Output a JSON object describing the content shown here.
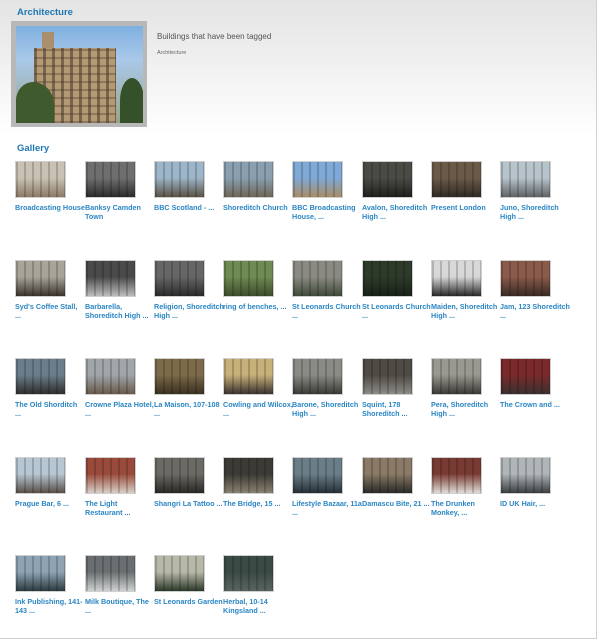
{
  "header": {
    "title": "Architecture",
    "description": "Buildings that have been tagged",
    "category": "Architecture"
  },
  "gallery": {
    "title": "Gallery",
    "items": [
      {
        "caption": "Broadcasting House"
      },
      {
        "caption": "Banksy Camden Town"
      },
      {
        "caption": "BBC Scotland - ..."
      },
      {
        "caption": "Shoreditch Church"
      },
      {
        "caption": "BBC Broadcasting House, ..."
      },
      {
        "caption": "Avalon, Shoreditch High ..."
      },
      {
        "caption": "Present London"
      },
      {
        "caption": "Juno, Shoreditch High ..."
      },
      {
        "caption": "Syd's Coffee Stall, ..."
      },
      {
        "caption": "Barbarella, Shoreditch High ..."
      },
      {
        "caption": "Religion, Shoreditch High ..."
      },
      {
        "caption": "ring of benches, ..."
      },
      {
        "caption": "St Leonards Church ..."
      },
      {
        "caption": "St Leonards Church ..."
      },
      {
        "caption": "Maiden, Shoreditch High ..."
      },
      {
        "caption": "Jam, 123 Shoreditch ..."
      },
      {
        "caption": "The Old Shorditch ..."
      },
      {
        "caption": "Crowne Plaza Hotel, ..."
      },
      {
        "caption": "La Maison, 107-108 ..."
      },
      {
        "caption": "Cowling and Wilcox, ..."
      },
      {
        "caption": "Barone, Shoreditch High ..."
      },
      {
        "caption": "Squint, 178 Shoreditch ..."
      },
      {
        "caption": "Pera, Shoreditch High ..."
      },
      {
        "caption": "The Crown and ..."
      },
      {
        "caption": "Prague Bar, 6 ..."
      },
      {
        "caption": "The Light Restaurant ..."
      },
      {
        "caption": "Shangri La Tattoo ..."
      },
      {
        "caption": "The Bridge, 15 ..."
      },
      {
        "caption": "Lifestyle Bazaar, 11a ..."
      },
      {
        "caption": "Damascu Bite, 21 ..."
      },
      {
        "caption": "The Drunken Monkey, ..."
      },
      {
        "caption": "ID UK Hair, ..."
      },
      {
        "caption": "Ink Publishing, 141-143 ..."
      },
      {
        "caption": "Milk Boutique, The ..."
      },
      {
        "caption": "St Leonards Garden"
      },
      {
        "caption": "Herbal, 10-14 Kingsland ..."
      }
    ]
  }
}
